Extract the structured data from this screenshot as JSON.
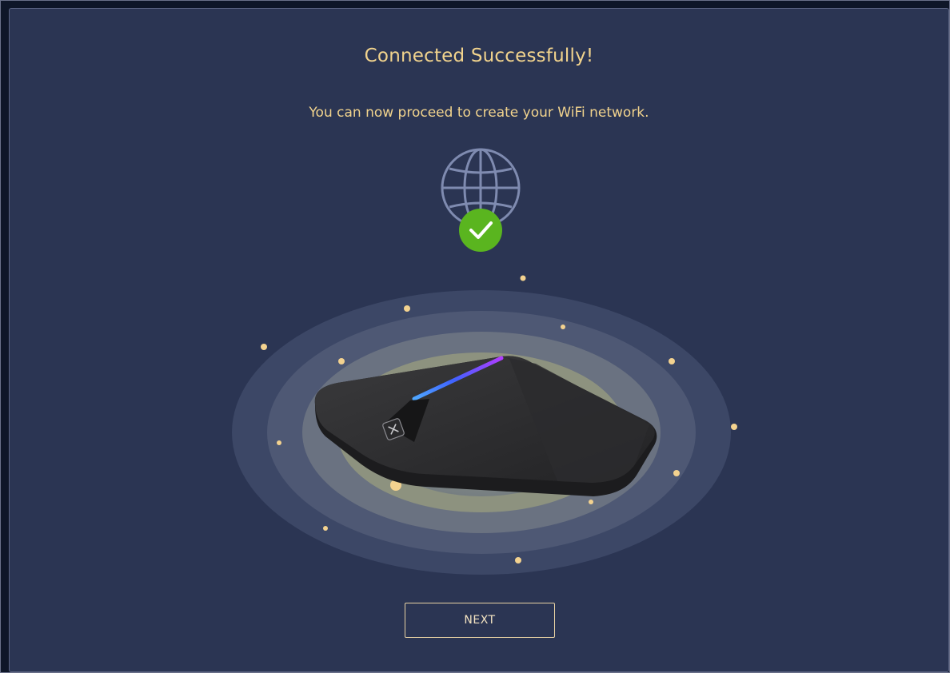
{
  "wizard": {
    "title": "Connected Successfully!",
    "subtitle": "You can now proceed to create your WiFi network.",
    "next_label": "NEXT"
  },
  "icons": {
    "globe": "globe-icon",
    "success": "checkmark-icon",
    "device": "router-illustration"
  },
  "colors": {
    "background": "#2b3553",
    "text_accent": "#f1d38d",
    "success_green": "#5ab51f",
    "globe_stroke": "#7f8bb0",
    "button_border": "#e9d3a4"
  }
}
